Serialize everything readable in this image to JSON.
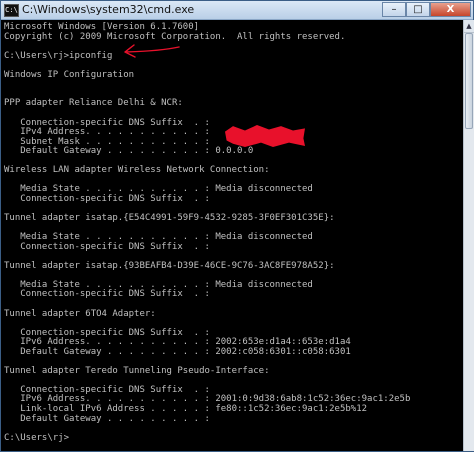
{
  "window": {
    "title": "C:\\Windows\\system32\\cmd.exe",
    "app_icon_label": "C:\\",
    "minimize_glyph": "–",
    "maximize_glyph": "□",
    "close_glyph": "X"
  },
  "console": {
    "lines": [
      "Microsoft Windows [Version 6.1.7600]",
      "Copyright (c) 2009 Microsoft Corporation.  All rights reserved.",
      "",
      "C:\\Users\\rj>ipconfig",
      "",
      "Windows IP Configuration",
      "",
      "",
      "PPP adapter Reliance Delhi & NCR:",
      "",
      "   Connection-specific DNS Suffix  . :",
      "   IPv4 Address. . . . . . . . . . . :",
      "   Subnet Mask . . . . . . . . . . . :",
      "   Default Gateway . . . . . . . . . : 0.0.0.0",
      "",
      "Wireless LAN adapter Wireless Network Connection:",
      "",
      "   Media State . . . . . . . . . . . : Media disconnected",
      "   Connection-specific DNS Suffix  . :",
      "",
      "Tunnel adapter isatap.{E54C4991-59F9-4532-9285-3F0EF301C35E}:",
      "",
      "   Media State . . . . . . . . . . . : Media disconnected",
      "   Connection-specific DNS Suffix  . :",
      "",
      "Tunnel adapter isatap.{93BEAFB4-D39E-46CE-9C76-3AC8FE978A52}:",
      "",
      "   Media State . . . . . . . . . . . : Media disconnected",
      "   Connection-specific DNS Suffix  . :",
      "",
      "Tunnel adapter 6TO4 Adapter:",
      "",
      "   Connection-specific DNS Suffix  . :",
      "   IPv6 Address. . . . . . . . . . . : 2002:653e:d1a4::653e:d1a4",
      "   Default Gateway . . . . . . . . . : 2002:c058:6301::c058:6301",
      "",
      "Tunnel adapter Teredo Tunneling Pseudo-Interface:",
      "",
      "   Connection-specific DNS Suffix  . :",
      "   IPv6 Address. . . . . . . . . . . : 2001:0:9d38:6ab8:1c52:36ec:9ac1:2e5b",
      "   Link-local IPv6 Address . . . . . : fe80::1c52:36ec:9ac1:2e5b%12",
      "   Default Gateway . . . . . . . . . :",
      "",
      "C:\\Users\\rj>"
    ]
  },
  "scrollbar": {
    "up_glyph": "▲"
  },
  "annotation": {
    "color": "#e8112b",
    "redaction_color": "#e8112b"
  }
}
